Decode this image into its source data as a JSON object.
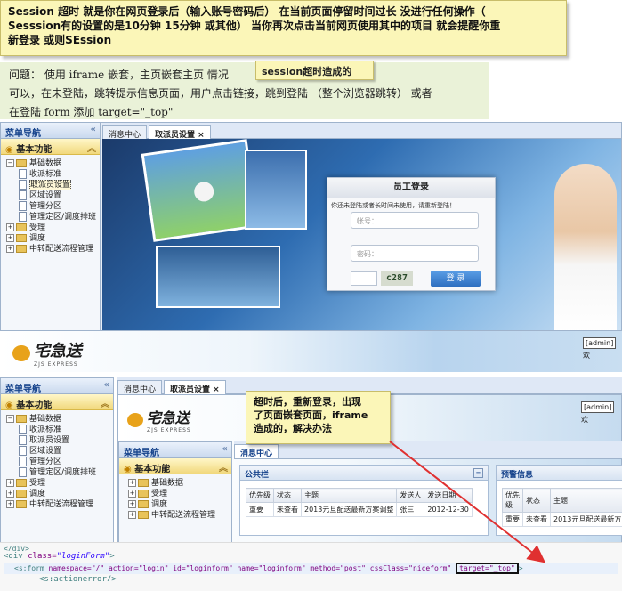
{
  "note_top": {
    "line1": "Session 超时  就是你在网页登录后（输入账号密码后）     在当前页面停留时间过长  没进行任何操作（",
    "line2": "Sesssion有的设置的是10分钟  15分钟  或其他）    当你再次点击当前网页使用其中的项目     就会提醒你重",
    "line3": "新登录  或则SEssion"
  },
  "note_session": "session超时造成的",
  "problem": {
    "line1": "问题：  使用 iframe 嵌套，主页嵌套主页  情况",
    "line2": "可以，在未登陆，跳转提示信息页面，用户点击链接，跳到登陆 （整个浏览器跳转） 或者",
    "line3": "在登陆 form 添加  target=\"_top\""
  },
  "upper": {
    "menu_title": "菜单导航",
    "section": "基本功能",
    "tree": [
      "基础数据",
      "收派标准",
      "取派员设置",
      "区域设置",
      "管理分区",
      "管理定区/调度排班",
      "受理",
      "调度",
      "中转配送流程管理"
    ],
    "tabs": [
      "消息中心",
      "取派员设置"
    ],
    "login": {
      "title": "员工登录",
      "message": "你还未登陆或者长时间未使用，请重新登陆！",
      "account_placeholder": "帐号：",
      "password_placeholder": "密码：",
      "captcha": "c287",
      "button": "登 录"
    }
  },
  "lower": {
    "logo": "宅急送",
    "logo_sub": "ZJS EXPRESS",
    "admin": "[admin]",
    "admin_suffix": "欢",
    "menu_title": "菜单导航",
    "section": "基本功能",
    "tree": [
      "基础数据",
      "收派标准",
      "取派员设置",
      "区域设置",
      "管理分区",
      "管理定区/调度排班",
      "受理",
      "调度",
      "中转配送流程管理"
    ],
    "tabs": [
      "消息中心",
      "取派员设置"
    ],
    "inner_tree": [
      "基础数据",
      "受理",
      "调度",
      "中转配送流程管理"
    ],
    "inner_tab": "消息中心",
    "notice_title": "公共栏",
    "alert_title": "预警信息",
    "notice_headers": [
      "优先级",
      "状态",
      "主题",
      "发送人",
      "发送日期"
    ],
    "notice_row": [
      "重要",
      "未查看",
      "2013元旦配送最新方案调整",
      "张三",
      "2012-12-30"
    ],
    "alert_headers": [
      "优先级",
      "状态",
      "主题"
    ],
    "alert_row": [
      "重要",
      "未查看",
      "2013元旦配送最新方"
    ]
  },
  "note_timeout": {
    "line1": "超时后，重新登录，出现",
    "line2": "了页面嵌套页面，iframe",
    "line3": "造成的，解决办法"
  },
  "code": {
    "line0": "</div>",
    "line1_tag": "<div",
    "line1_attr": "class=",
    "line1_val": "\"loginForm\"",
    "line1_end": ">",
    "line2_tag": "<s:form",
    "line2_rest": "namespace=\"/\" action=\"login\" id=\"loginform\" name=\"loginform\" method=\"post\" cssClass=\"niceform\"",
    "line2_target": "target=\"_top\"",
    "line2_end": ">",
    "line3": "<s:actionerror/>"
  },
  "colors": {
    "note": "#fbf6b8",
    "arrow": "#e03030",
    "problem_bg": "#eaf2d8"
  }
}
